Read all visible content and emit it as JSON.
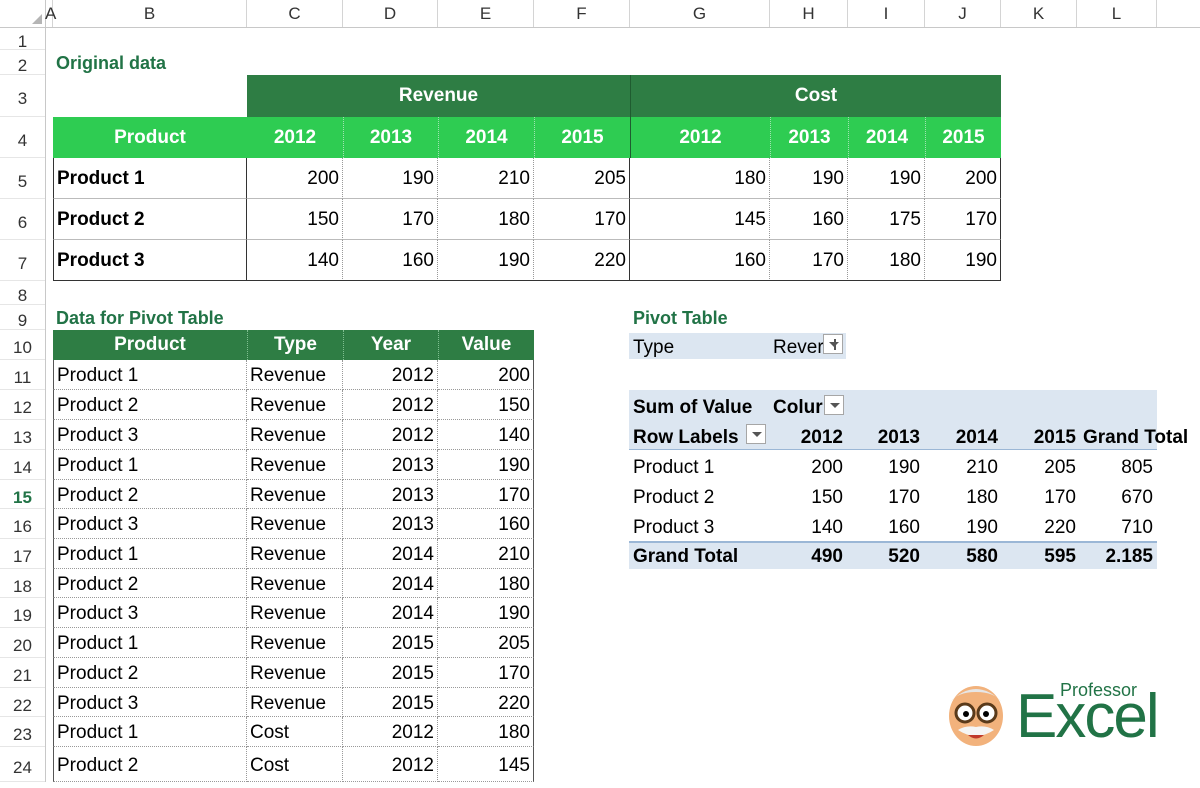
{
  "columns": [
    "A",
    "B",
    "C",
    "D",
    "E",
    "F",
    "G",
    "H",
    "I",
    "J",
    "K",
    "L"
  ],
  "rows": [
    "1",
    "2",
    "3",
    "4",
    "5",
    "6",
    "7",
    "8",
    "9",
    "10",
    "11",
    "12",
    "13",
    "14",
    "15",
    "16",
    "17",
    "18",
    "19",
    "20",
    "21",
    "22",
    "23",
    "24"
  ],
  "selected_row": "15",
  "original": {
    "title": "Original data",
    "revenue_label": "Revenue",
    "cost_label": "Cost",
    "product_label": "Product",
    "years": [
      "2012",
      "2013",
      "2014",
      "2015"
    ],
    "rows": [
      {
        "name": "Product 1",
        "revenue": [
          "200",
          "190",
          "210",
          "205"
        ],
        "cost": [
          "180",
          "190",
          "190",
          "200"
        ]
      },
      {
        "name": "Product 2",
        "revenue": [
          "150",
          "170",
          "180",
          "170"
        ],
        "cost": [
          "145",
          "160",
          "175",
          "170"
        ]
      },
      {
        "name": "Product 3",
        "revenue": [
          "140",
          "160",
          "190",
          "220"
        ],
        "cost": [
          "160",
          "170",
          "180",
          "190"
        ]
      }
    ]
  },
  "flat": {
    "title": "Data for Pivot Table",
    "headers": [
      "Product",
      "Type",
      "Year",
      "Value"
    ],
    "rows": [
      [
        "Product 1",
        "Revenue",
        "2012",
        "200"
      ],
      [
        "Product 2",
        "Revenue",
        "2012",
        "150"
      ],
      [
        "Product 3",
        "Revenue",
        "2012",
        "140"
      ],
      [
        "Product 1",
        "Revenue",
        "2013",
        "190"
      ],
      [
        "Product 2",
        "Revenue",
        "2013",
        "170"
      ],
      [
        "Product 3",
        "Revenue",
        "2013",
        "160"
      ],
      [
        "Product 1",
        "Revenue",
        "2014",
        "210"
      ],
      [
        "Product 2",
        "Revenue",
        "2014",
        "180"
      ],
      [
        "Product 3",
        "Revenue",
        "2014",
        "190"
      ],
      [
        "Product 1",
        "Revenue",
        "2015",
        "205"
      ],
      [
        "Product 2",
        "Revenue",
        "2015",
        "170"
      ],
      [
        "Product 3",
        "Revenue",
        "2015",
        "220"
      ],
      [
        "Product 1",
        "Cost",
        "2012",
        "180"
      ],
      [
        "Product 2",
        "Cost",
        "2012",
        "145"
      ]
    ]
  },
  "pivot": {
    "title": "Pivot Table",
    "filter_label": "Type",
    "filter_value": "Rever",
    "sum_label": "Sum of Value",
    "col_label": "Colur",
    "row_labels": "Row Labels",
    "years": [
      "2012",
      "2013",
      "2014",
      "2015"
    ],
    "grand_total_header": "Grand Total",
    "rows": [
      {
        "name": "Product 1",
        "values": [
          "200",
          "190",
          "210",
          "205"
        ],
        "total": "805"
      },
      {
        "name": "Product 2",
        "values": [
          "150",
          "170",
          "180",
          "170"
        ],
        "total": "670"
      },
      {
        "name": "Product 3",
        "values": [
          "140",
          "160",
          "190",
          "220"
        ],
        "total": "710"
      }
    ],
    "grand_total_label": "Grand Total",
    "grand_totals": [
      "490",
      "520",
      "580",
      "595"
    ],
    "grand_total_all": "2.185"
  },
  "logo": {
    "small": "Professor",
    "big": "Excel",
    "color": "#217346"
  }
}
